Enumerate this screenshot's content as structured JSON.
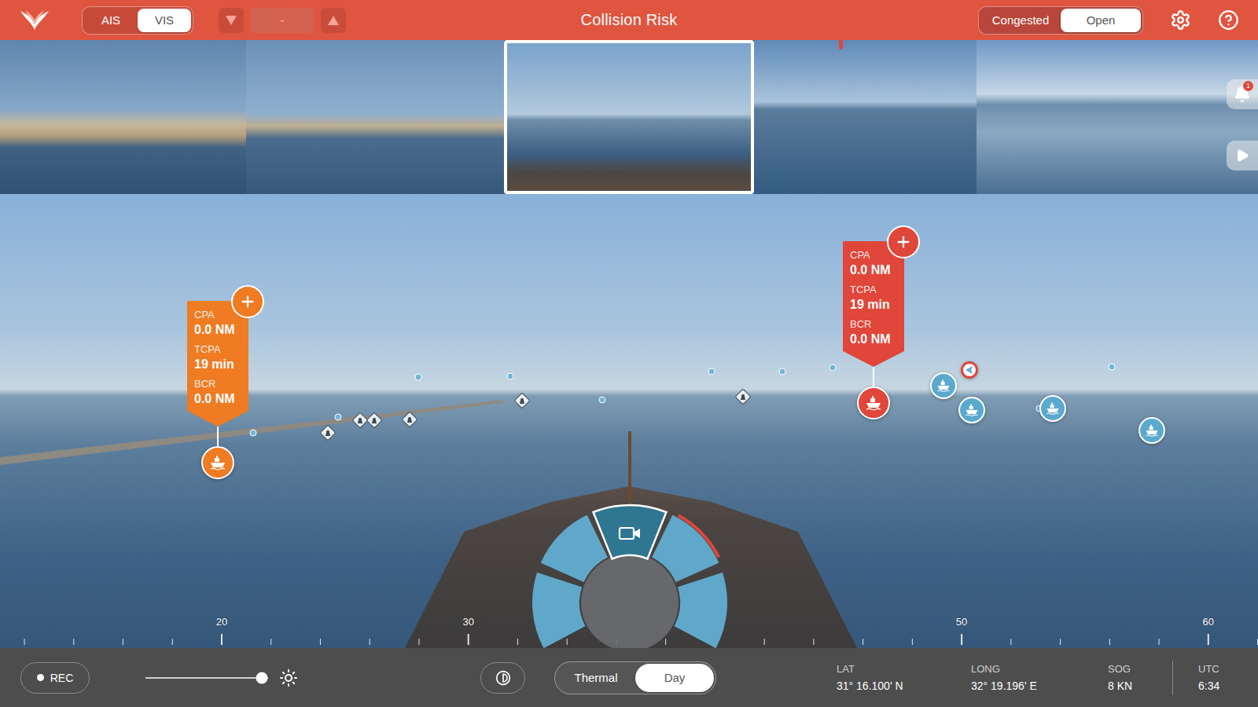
{
  "top_bar": {
    "title": "Collision Risk",
    "source_toggle": [
      {
        "label": "AIS",
        "selected": false
      },
      {
        "label": "VIS",
        "selected": true
      }
    ],
    "zoom_value": "-",
    "traffic_toggle": [
      {
        "label": "Congested",
        "selected": false
      },
      {
        "label": "Open",
        "selected": true
      }
    ]
  },
  "cameras": [
    {
      "selected": false
    },
    {
      "selected": false
    },
    {
      "selected": true
    },
    {
      "selected": false
    },
    {
      "selected": false
    }
  ],
  "notifications": {
    "count": "1"
  },
  "vessels": [
    {
      "kind": "vessel",
      "color": "#ef7b22",
      "alert": {
        "metrics": [
          {
            "label": "CPA",
            "value": "0.0 NM"
          },
          {
            "label": "TCPA",
            "value": "19 min"
          },
          {
            "label": "BCR",
            "value": "0.0 NM"
          }
        ]
      }
    },
    {
      "kind": "vessel",
      "color": "#e0463a",
      "alert": {
        "metrics": [
          {
            "label": "CPA",
            "value": "0.0 NM"
          },
          {
            "label": "TCPA",
            "value": "19 min"
          },
          {
            "label": "BCR",
            "value": "0.0 NM"
          }
        ]
      }
    },
    {
      "kind": "vessel",
      "color": "#5aa9cf",
      "alert": null
    },
    {
      "kind": "vessel",
      "color": "#5aa9cf",
      "alert": null
    },
    {
      "kind": "vessel",
      "color": "#5aa9cf",
      "alert": null
    },
    {
      "kind": "vessel",
      "color": "#5aa9cf",
      "alert": null
    },
    {
      "kind": "contact",
      "color": "#e0463a",
      "alert": null
    }
  ],
  "bearing_scale": {
    "labels": [
      "20",
      "30",
      "50",
      "60"
    ]
  },
  "compass": {
    "sectors": [
      {
        "selected": false,
        "alert": false
      },
      {
        "selected": false,
        "alert": false
      },
      {
        "selected": true,
        "alert": false
      },
      {
        "selected": false,
        "alert": true
      },
      {
        "selected": false,
        "alert": false
      }
    ]
  },
  "bottom_bar": {
    "rec_label": "REC",
    "recording": false,
    "brightness": {
      "level": 0.95
    },
    "mode_toggle": [
      {
        "label": "Thermal",
        "selected": false
      },
      {
        "label": "Day",
        "selected": true
      }
    ],
    "readouts": [
      {
        "label": "LAT",
        "value": "31° 16.100' N"
      },
      {
        "label": "LONG",
        "value": "32° 19.196' E"
      },
      {
        "label": "SOG",
        "value": "8 KN"
      },
      {
        "label": "UTC",
        "value": "6:34"
      }
    ]
  }
}
